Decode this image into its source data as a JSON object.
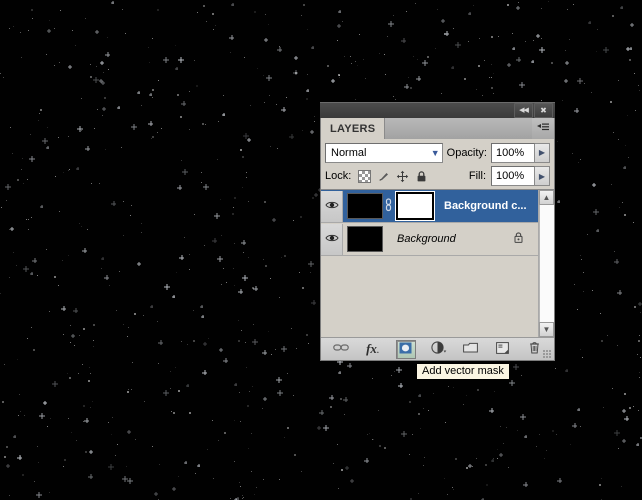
{
  "canvas": {
    "background_color": "#010101",
    "description": "starfield"
  },
  "panel": {
    "title_tab": "LAYERS",
    "titlebar": {
      "collapse_icon": "double-chevron-left-icon",
      "collapse_glyph": "◀◀",
      "close_icon": "close-icon",
      "close_glyph": "✖"
    },
    "menu_icon": "panel-menu-icon",
    "blend": {
      "label": "",
      "value": "Normal",
      "caret": "▼"
    },
    "opacity": {
      "label": "Opacity:",
      "value": "100%",
      "spinner": "▶"
    },
    "fill": {
      "label": "Fill:",
      "value": "100%",
      "spinner": "▶"
    },
    "lock": {
      "label": "Lock:",
      "icons": [
        "lock-transparent-pixels-icon",
        "lock-image-pixels-icon",
        "lock-position-icon",
        "lock-all-icon"
      ]
    },
    "layers": [
      {
        "name": "Background c...",
        "selected": true,
        "visible": true,
        "visibility_icon": "eye-icon",
        "thumbnail_color": "#000000",
        "has_link": true,
        "link_icon": "chain-link-icon",
        "has_mask": true,
        "mask_color": "#ffffff",
        "locked": false,
        "italic": false
      },
      {
        "name": "Background",
        "selected": false,
        "visible": true,
        "visibility_icon": "eye-icon",
        "thumbnail_color": "#000000",
        "has_link": false,
        "has_mask": false,
        "locked": true,
        "lock_icon": "padlock-icon",
        "italic": true
      }
    ],
    "scrollbar": {
      "up_arrow": "▲",
      "down_arrow": "▼"
    },
    "footer_buttons": [
      {
        "name": "link-layers-button",
        "icon": "chain-link-icon",
        "active": false
      },
      {
        "name": "layer-style-button",
        "icon": "fx-icon",
        "active": false,
        "label": "fx"
      },
      {
        "name": "add-vector-mask-button",
        "icon": "vector-mask-icon",
        "active": true
      },
      {
        "name": "new-adjustment-layer-button",
        "icon": "half-circle-icon",
        "active": false
      },
      {
        "name": "new-group-button",
        "icon": "folder-icon",
        "active": false
      },
      {
        "name": "new-layer-button",
        "icon": "new-layer-icon",
        "active": false
      },
      {
        "name": "delete-layer-button",
        "icon": "trash-icon",
        "active": false
      }
    ],
    "resize_grip_icon": "resize-grip-icon"
  },
  "tooltip": {
    "text": "Add vector mask"
  }
}
